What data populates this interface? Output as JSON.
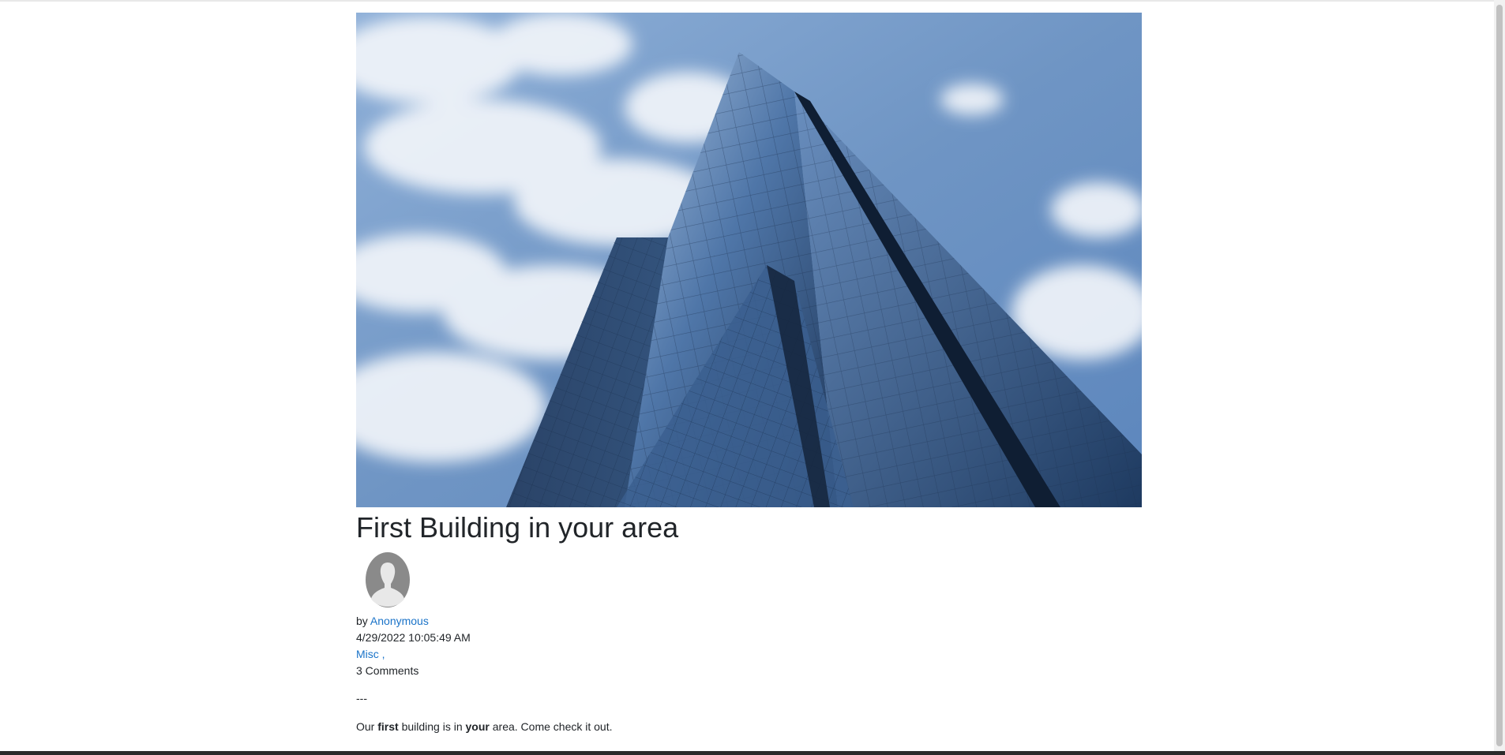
{
  "post": {
    "title": "First Building in your area",
    "image_alt": "Glass skyscraper against a cloudy blue sky",
    "author_prefix": "by",
    "author": "Anonymous",
    "date": "4/29/2022 10:05:49 AM",
    "category": "Misc",
    "category_suffix": " ,",
    "comments": "3 Comments",
    "separator": "---",
    "body": {
      "part1": "Our ",
      "bold1": "first",
      "part2": " building is in ",
      "bold2": "your",
      "part3": " area. Come check it out."
    }
  },
  "colors": {
    "link": "#1a73c8",
    "text": "#212529",
    "sky": "#7fa3cf",
    "glass": "#2d4a72"
  }
}
